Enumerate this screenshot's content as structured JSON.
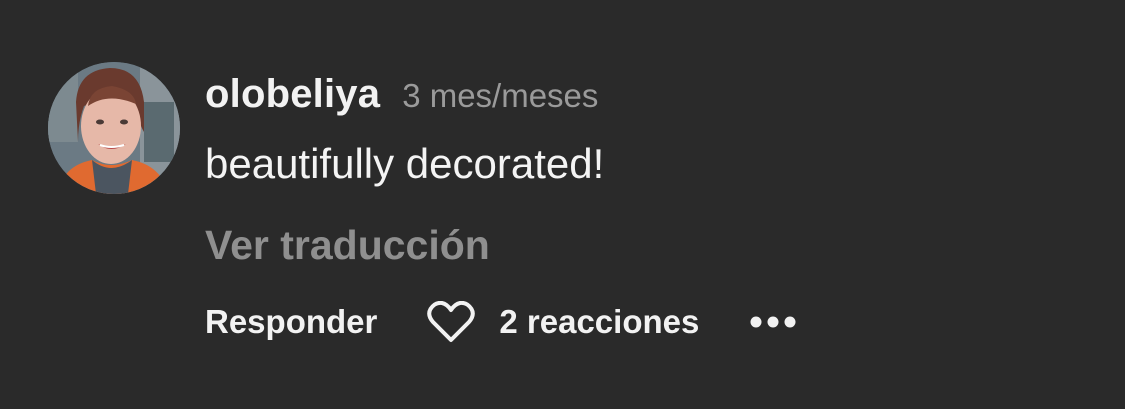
{
  "comment": {
    "username": "olobeliya",
    "time": "3 mes/meses",
    "text": "beautifully decorated!",
    "translate_label": "Ver traducción",
    "reply_label": "Responder",
    "reactions_label": "2 reacciones",
    "avatar_icon": "user-avatar-photo",
    "like_icon": "heart-outline-icon",
    "more_icon": "more-dots-icon"
  },
  "colors": {
    "background": "#2a2a2a",
    "primary_text": "#f2f2f2",
    "secondary_text": "#9a9a9a"
  }
}
